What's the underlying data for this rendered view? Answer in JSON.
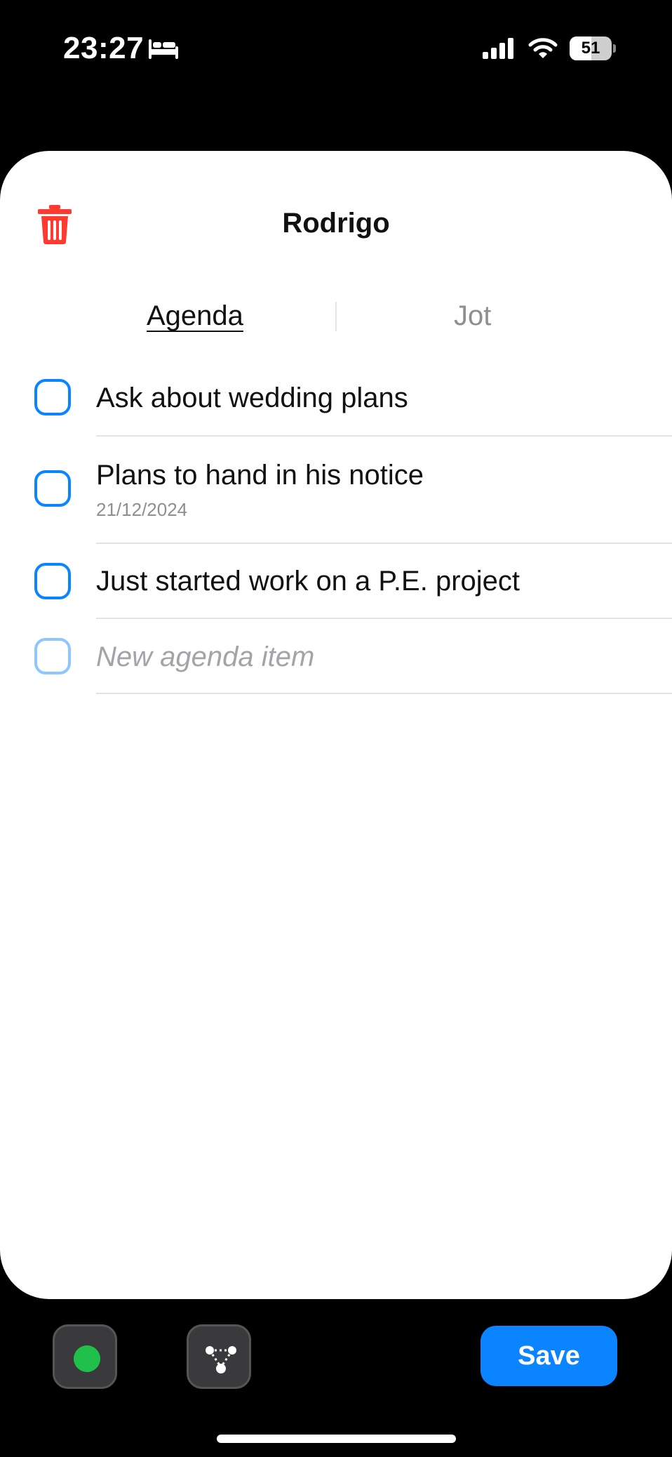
{
  "status_bar": {
    "time": "23:27",
    "battery_level": "51",
    "icons": [
      "bed-icon",
      "cellular-signal-icon",
      "wifi-icon",
      "battery-icon"
    ]
  },
  "sheet": {
    "title": "Rodrigo",
    "delete_icon": "trash-icon",
    "delete_color": "#ff3b30"
  },
  "tabs": [
    {
      "label": "Agenda",
      "selected": true
    },
    {
      "label": "Jot",
      "selected": false
    }
  ],
  "agenda": {
    "items": [
      {
        "title": "Ask about wedding plans",
        "date": "",
        "checked": false
      },
      {
        "title": "Plans to hand in his notice",
        "date": "21/12/2024",
        "checked": false
      },
      {
        "title": "Just started work on a P.E. project",
        "date": "",
        "checked": false
      }
    ],
    "new_item_placeholder": "New agenda item"
  },
  "toolbar": {
    "status_icon": "green-status-dot-icon",
    "status_color": "#1fc14a",
    "graph_icon": "connections-graph-icon",
    "save_label": "Save",
    "accent_color": "#0a84ff"
  }
}
